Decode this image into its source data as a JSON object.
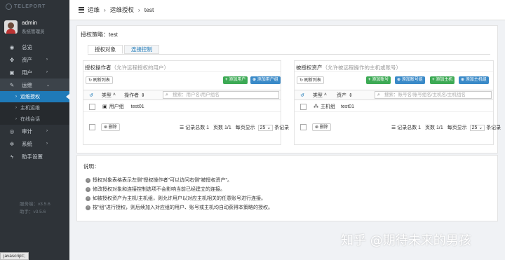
{
  "sidebar": {
    "logo_text": "TELEPORT",
    "user_name": "admin",
    "user_role": "系统管理员",
    "nav": [
      {
        "label": "总览",
        "icon": "dashboard-icon"
      },
      {
        "label": "资产",
        "icon": "cubes-icon"
      },
      {
        "label": "用户",
        "icon": "users-icon"
      },
      {
        "label": "运维",
        "icon": "wrench-icon"
      },
      {
        "label": "审计",
        "icon": "eye-icon"
      },
      {
        "label": "系统",
        "icon": "gear-icon"
      },
      {
        "label": "助手设置",
        "icon": "bolt-icon"
      }
    ],
    "ops_subitems": [
      "运维授权",
      "主机运维",
      "在线会话"
    ],
    "versions": [
      "服务端：v3.5.6",
      "助手：v3.5.6"
    ]
  },
  "topbar": {
    "breadcrumb": [
      "运维",
      "运维授权",
      "test"
    ]
  },
  "policy": {
    "label": "授权策略：test",
    "tabs": [
      "授权对象",
      "连接控制"
    ]
  },
  "left_box": {
    "title": "授权操作者",
    "hint": "（允许远程授权的用户）",
    "refresh": "刷新列表",
    "add_user": "添加用户",
    "add_user_group": "添加用户组",
    "col_type": "类型",
    "col_operator": "操作者",
    "search_placeholder": "搜索：用户名/用户组名",
    "rows": [
      {
        "type": "用户组",
        "name": "test01"
      }
    ],
    "delete": "删除",
    "pager_total": "记录总数 1",
    "pager_page": "页数 1/1",
    "pager_per": "每页显示",
    "pager_size": "25",
    "pager_unit": "条记录"
  },
  "right_box": {
    "title": "被授权资产",
    "hint": "（允许被远程操作的主机或账号）",
    "refresh": "刷新列表",
    "add_account": "添加账号",
    "add_account_group": "添加账号组",
    "add_host": "添加主机",
    "add_host_group": "添加主机组",
    "col_type": "类型",
    "col_asset": "资产",
    "search_placeholder": "搜索：账号名/账号组名/主机名/主机组名",
    "rows": [
      {
        "type": "主机组",
        "name": "test01"
      }
    ],
    "delete": "删除",
    "pager_total": "记录总数 1",
    "pager_page": "页数 1/1",
    "pager_per": "每页显示",
    "pager_size": "25",
    "pager_unit": "条记录"
  },
  "notes": {
    "title": "说明：",
    "items": [
      "授权对象表格表示左侧\"授权操作者\"可以访问右侧\"被授权资产\"。",
      "修改授权对象和连接控制选项不会影响当前已经建立的连接。",
      "如被授权资产为主机/主机组，则允许用户以对应主机相关的任意账号进行连接。",
      "按\"组\"进行授权，则后续加入对应组的用户、账号或主机均自动获得本策略的授权。"
    ]
  },
  "watermark": "知乎 @期待未来的男孩",
  "status_bar": "javascript:;",
  "colors": {
    "sidebar_bg": "#2e3338",
    "accent": "#1f7ab8",
    "green": "#3daa55",
    "blue": "#3a8ac8"
  }
}
